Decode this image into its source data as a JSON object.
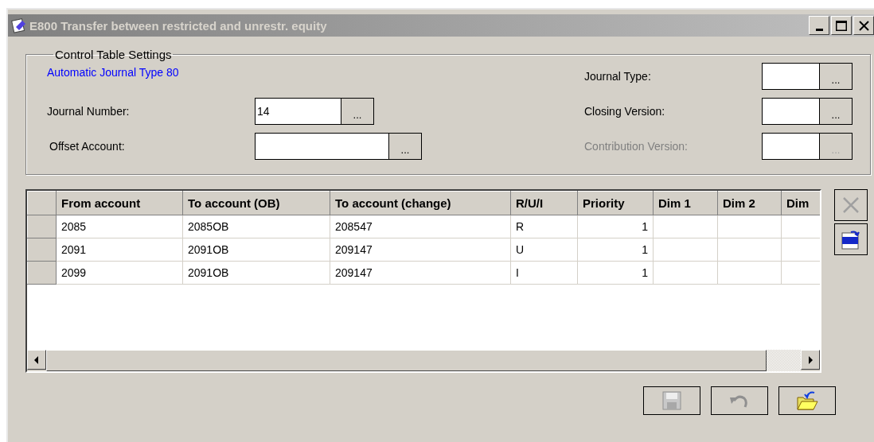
{
  "window": {
    "title": "E800 Transfer between restricted and unrestr. equity"
  },
  "settings": {
    "legend": "Control Table Settings",
    "link": "Automatic Journal Type 80",
    "left_fields": [
      {
        "label": "Journal Number:",
        "value": "14",
        "lookup": "...",
        "disabled": false
      },
      {
        "label": "Offset Account:",
        "lookup": "...",
        "disabled": false
      }
    ],
    "right_fields": [
      {
        "label": "Journal Type:",
        "lookup": "...",
        "disabled": false
      },
      {
        "label": "Closing Version:",
        "lookup": "...",
        "disabled": false
      },
      {
        "label": "Contribution Version:",
        "lookup": "...",
        "disabled": true
      }
    ]
  },
  "grid": {
    "columns": [
      {
        "label": "From account",
        "kind": "text"
      },
      {
        "label": "To account (OB)",
        "kind": "text"
      },
      {
        "label": "To account (change)",
        "kind": "text"
      },
      {
        "label": "R/U/I",
        "kind": "text"
      },
      {
        "label": "Priority",
        "kind": "number"
      },
      {
        "label": "Dim 1",
        "kind": "text"
      },
      {
        "label": "Dim 2",
        "kind": "text"
      },
      {
        "label": "Dim",
        "kind": "text"
      }
    ],
    "rows": [
      {
        "cells": [
          "2085",
          "2085OB",
          "208547",
          "R",
          "1"
        ]
      },
      {
        "cells": [
          "2091",
          "2091OB",
          "209147",
          "U",
          "1"
        ]
      },
      {
        "cells": [
          "2099",
          "2091OB",
          "209147",
          "I",
          "1"
        ]
      }
    ]
  },
  "side_tools": [
    {
      "kind": "delete",
      "disabled": true
    },
    {
      "kind": "export",
      "disabled": false
    }
  ],
  "actions": [
    {
      "kind": "save",
      "disabled": true
    },
    {
      "kind": "undo",
      "disabled": true
    },
    {
      "kind": "open",
      "disabled": false
    }
  ]
}
